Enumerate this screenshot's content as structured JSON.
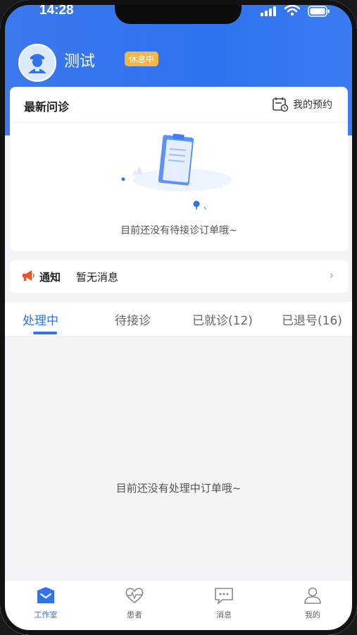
{
  "status_bar": {
    "time": "14:28"
  },
  "profile": {
    "name": "测试",
    "status_badge": "休息中"
  },
  "recent_consult": {
    "title": "最新问诊",
    "appointment_label": "我的预约",
    "empty_text": "目前还没有待接诊订单哦~"
  },
  "notice": {
    "title": "通知",
    "text": "暂无消息",
    "arrow": "›"
  },
  "tabs": [
    {
      "label": "处理中",
      "active": true
    },
    {
      "label": "待接诊",
      "active": false
    },
    {
      "label": "已就诊(12)",
      "active": false
    },
    {
      "label": "已退号(16)",
      "active": false
    }
  ],
  "empty_processing": "目前还没有处理中订单哦~",
  "bottom_nav": [
    {
      "label": "工作室",
      "icon": "workroom-icon",
      "active": true
    },
    {
      "label": "患者",
      "icon": "patient-heart-icon",
      "active": false
    },
    {
      "label": "消息",
      "icon": "message-icon",
      "active": false
    },
    {
      "label": "我的",
      "icon": "profile-icon",
      "active": false
    }
  ],
  "colors": {
    "primary": "#2f73f0",
    "badge": "#f6b545",
    "notice_icon": "#e8562e",
    "background": "#f3f4f7"
  }
}
